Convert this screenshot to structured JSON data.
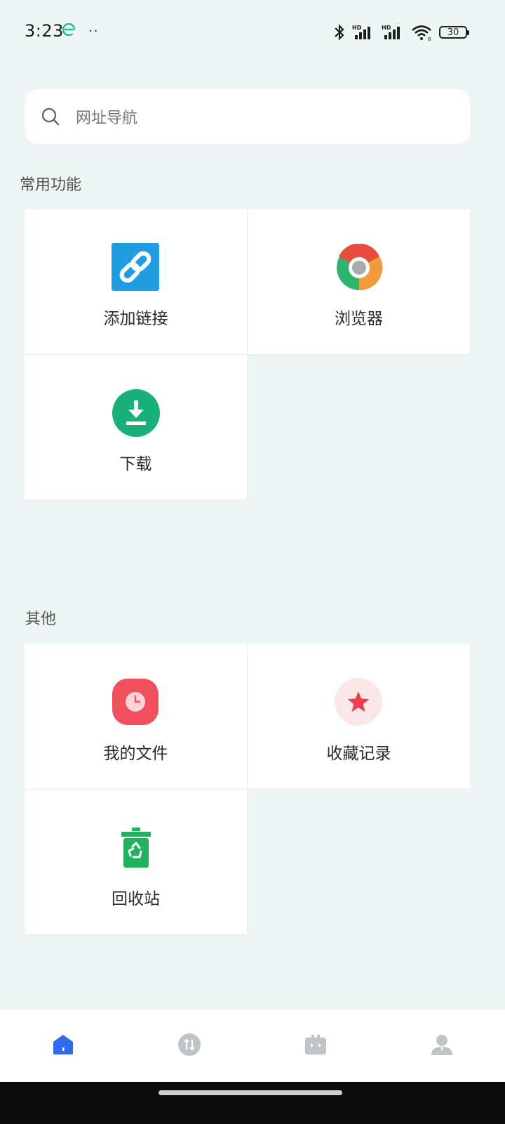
{
  "status_bar": {
    "time": "3:23",
    "dots": "··",
    "battery": "30"
  },
  "search": {
    "placeholder": "网址导航"
  },
  "sections": {
    "common": {
      "title": "常用功能",
      "items": [
        {
          "label": "添加链接",
          "icon": "link-icon",
          "color": "#1f9de0"
        },
        {
          "label": "浏览器",
          "icon": "browser-icon",
          "color": "#e84c3d"
        },
        {
          "label": "下载",
          "icon": "download-icon",
          "color": "#19b07a"
        }
      ]
    },
    "other": {
      "title": "其他",
      "items": [
        {
          "label": "我的文件",
          "icon": "clock-icon",
          "color": "#f0505c"
        },
        {
          "label": "收藏记录",
          "icon": "star-icon",
          "color": "#e84050"
        },
        {
          "label": "回收站",
          "icon": "recycle-bin-icon",
          "color": "#1fb35e"
        }
      ]
    }
  },
  "bottom_nav": {
    "active_color": "#2f6bf0",
    "inactive_color": "#bfc4c6",
    "items": [
      "home-icon",
      "transfer-icon",
      "toolbox-icon",
      "profile-icon"
    ]
  }
}
